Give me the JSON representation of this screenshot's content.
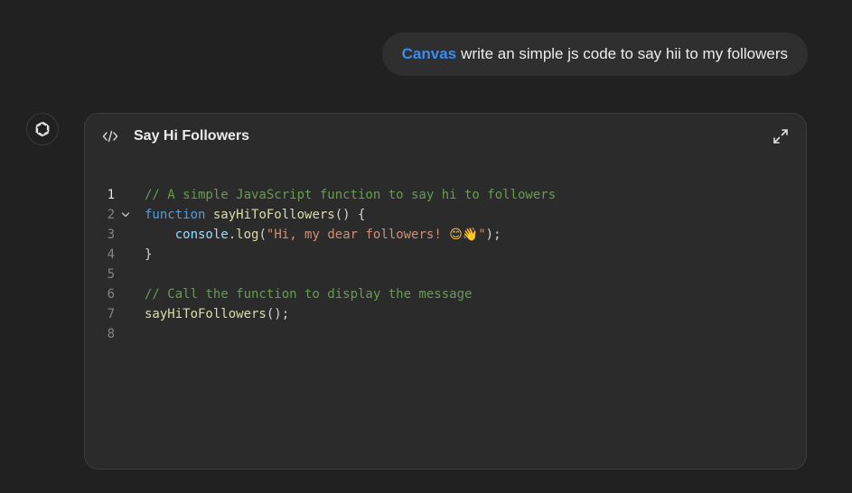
{
  "user_message": {
    "tag": "Canvas",
    "text": "write an simple js code to say hii to my followers"
  },
  "assistant": {
    "avatar_icon": "openai-logo-icon"
  },
  "canvas": {
    "code_icon": "code-icon",
    "title": "Say Hi Followers",
    "expand_icon": "expand-icon",
    "lines": [
      {
        "number": "1",
        "tokens": [
          {
            "type": "comment",
            "text": "// A simple JavaScript function to say hi to followers"
          }
        ]
      },
      {
        "number": "2",
        "tokens": [
          {
            "type": "keyword",
            "text": "function"
          },
          {
            "type": "plain",
            "text": " "
          },
          {
            "type": "func",
            "text": "sayHiToFollowers"
          },
          {
            "type": "plain",
            "text": "() {"
          }
        ]
      },
      {
        "number": "3",
        "tokens": [
          {
            "type": "plain",
            "text": "    "
          },
          {
            "type": "var",
            "text": "console"
          },
          {
            "type": "plain",
            "text": "."
          },
          {
            "type": "func",
            "text": "log"
          },
          {
            "type": "plain",
            "text": "("
          },
          {
            "type": "string",
            "text": "\"Hi, my dear followers! "
          },
          {
            "type": "emoji",
            "text": "😊👋"
          },
          {
            "type": "string",
            "text": "\""
          },
          {
            "type": "plain",
            "text": ");"
          }
        ]
      },
      {
        "number": "4",
        "tokens": [
          {
            "type": "plain",
            "text": "}"
          }
        ]
      },
      {
        "number": "5",
        "tokens": []
      },
      {
        "number": "6",
        "tokens": [
          {
            "type": "comment",
            "text": "// Call the function to display the message"
          }
        ]
      },
      {
        "number": "7",
        "tokens": [
          {
            "type": "func",
            "text": "sayHiToFollowers"
          },
          {
            "type": "plain",
            "text": "();"
          }
        ]
      },
      {
        "number": "8",
        "tokens": []
      }
    ],
    "active_line": "1",
    "foldable_line": "2"
  },
  "colors": {
    "background": "#212121",
    "bubble": "#2f2f2f",
    "canvas_tag": "#3b8cf0",
    "comment": "#6a9955",
    "keyword": "#569cd6",
    "function": "#dcdcaa",
    "variable": "#9cdcfe",
    "string": "#ce9178"
  }
}
